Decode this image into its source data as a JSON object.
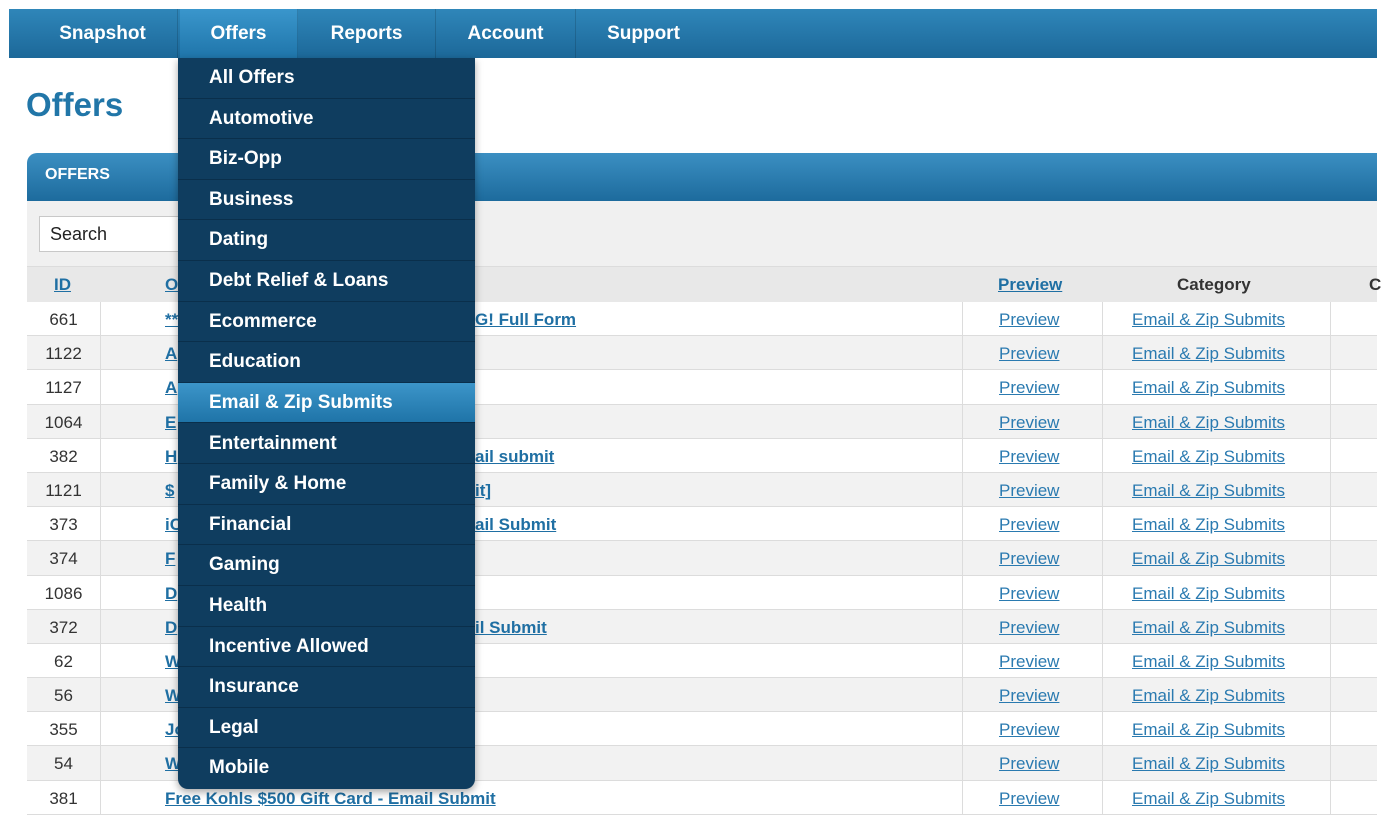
{
  "nav": {
    "tabs": [
      {
        "label": "Snapshot"
      },
      {
        "label": "Offers"
      },
      {
        "label": "Reports"
      },
      {
        "label": "Account"
      },
      {
        "label": "Support"
      }
    ],
    "active": "Offers"
  },
  "page_title": "Offers",
  "panel": {
    "title": "OFFERS",
    "search_placeholder": "Search"
  },
  "table": {
    "columns": {
      "id": "ID",
      "name": "O",
      "preview": "Preview",
      "category": "Category",
      "extra": "C"
    },
    "rows": [
      {
        "id": "661",
        "name": "**",
        "name_tail": "G! Full Form",
        "preview": "Preview",
        "category": "Email & Zip Submits"
      },
      {
        "id": "1122",
        "name": "A",
        "name_tail": "",
        "preview": "Preview",
        "category": "Email & Zip Submits"
      },
      {
        "id": "1127",
        "name": "A",
        "name_tail": "",
        "preview": "Preview",
        "category": "Email & Zip Submits"
      },
      {
        "id": "1064",
        "name": "E",
        "name_tail": "",
        "preview": "Preview",
        "category": "Email & Zip Submits"
      },
      {
        "id": "382",
        "name": "H",
        "name_tail": "ail submit",
        "preview": "Preview",
        "category": "Email & Zip Submits"
      },
      {
        "id": "1121",
        "name": "$",
        "name_tail": "it]",
        "preview": "Preview",
        "category": "Email & Zip Submits"
      },
      {
        "id": "373",
        "name": "iC",
        "name_tail": "ail Submit",
        "preview": "Preview",
        "category": "Email & Zip Submits"
      },
      {
        "id": "374",
        "name": "F",
        "name_tail": "",
        "preview": "Preview",
        "category": "Email & Zip Submits"
      },
      {
        "id": "1086",
        "name": "D",
        "name_tail": "",
        "preview": "Preview",
        "category": "Email & Zip Submits"
      },
      {
        "id": "372",
        "name": "D",
        "name_tail": "il Submit",
        "preview": "Preview",
        "category": "Email & Zip Submits"
      },
      {
        "id": "62",
        "name": "W",
        "name_tail": "",
        "preview": "Preview",
        "category": "Email & Zip Submits"
      },
      {
        "id": "56",
        "name": "W",
        "name_tail": "",
        "preview": "Preview",
        "category": "Email & Zip Submits"
      },
      {
        "id": "355",
        "name": "Jo",
        "name_tail": "",
        "preview": "Preview",
        "category": "Email & Zip Submits"
      },
      {
        "id": "54",
        "name": "W",
        "name_tail": "",
        "preview": "Preview",
        "category": "Email & Zip Submits"
      },
      {
        "id": "381",
        "name": "Free Kohls $500 Gift Card - Email Submit",
        "name_tail": "",
        "preview": "Preview",
        "category": "Email & Zip Submits"
      }
    ]
  },
  "dropdown": {
    "items": [
      "All Offers",
      "Automotive",
      "Biz-Opp",
      "Business",
      "Dating",
      "Debt Relief & Loans",
      "Ecommerce",
      "Education",
      "Email & Zip Submits",
      "Entertainment",
      "Family & Home",
      "Financial",
      "Gaming",
      "Health",
      "Incentive Allowed",
      "Insurance",
      "Legal",
      "Mobile"
    ],
    "highlighted": "Email & Zip Submits"
  },
  "colors": {
    "nav_bg": "#1c6899",
    "dropdown_bg": "#0f3d5f",
    "highlight": "#2a83bb",
    "link": "#1f6fa3",
    "title": "#2176a8"
  }
}
